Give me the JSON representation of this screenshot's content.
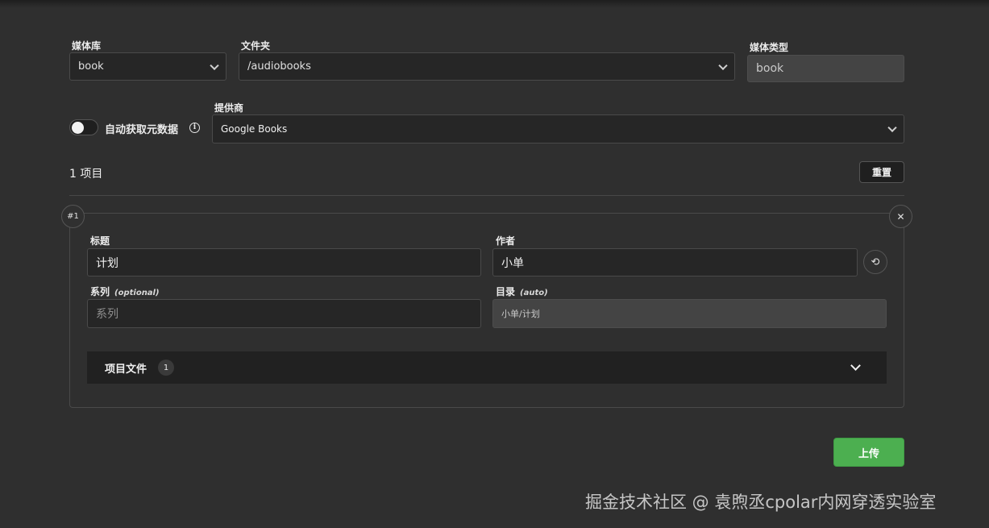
{
  "form": {
    "library": {
      "label": "媒体库",
      "value": "book"
    },
    "folder": {
      "label": "文件夹",
      "value": "/audiobooks"
    },
    "media_type": {
      "label": "媒体类型",
      "value": "book"
    },
    "auto_fetch": {
      "label": "自动获取元数据",
      "enabled": false,
      "info_glyph": "i"
    },
    "provider": {
      "label": "提供商",
      "value": "Google Books"
    }
  },
  "items_header": {
    "count_text": "1 项目",
    "reset_label": "重置"
  },
  "item": {
    "index_badge": "#1",
    "close_glyph": "✕",
    "refresh_glyph": "⟲",
    "title": {
      "label": "标题",
      "value": "计划"
    },
    "author": {
      "label": "作者",
      "value": "小单"
    },
    "series": {
      "label": "系列",
      "hint": "(optional)",
      "placeholder": "系列"
    },
    "directory": {
      "label": "目录",
      "hint": "(auto)",
      "value": "小单/计划"
    },
    "files": {
      "label": "项目文件",
      "count": "1"
    }
  },
  "upload_label": "上传",
  "watermark": "掘金技术社区 @ 袁煦丞cpolar内网穿透实验室",
  "colors": {
    "accent_green": "#4caf50",
    "background": "#2f2f2f",
    "input_bg": "#262626"
  }
}
